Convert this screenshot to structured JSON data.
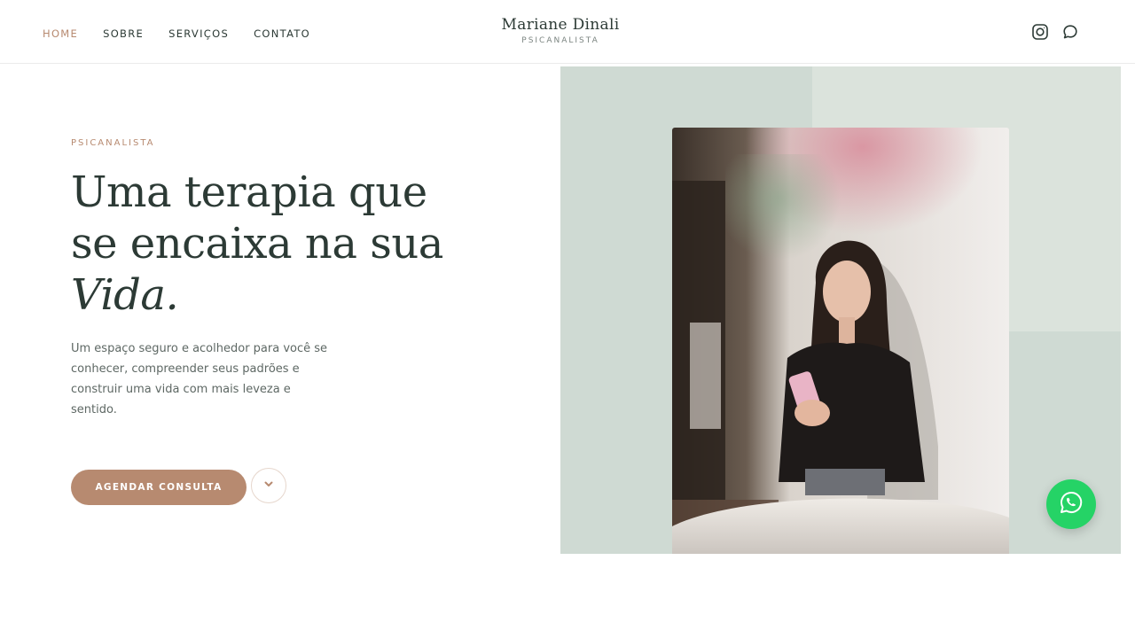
{
  "nav": {
    "items": [
      {
        "label": "HOME",
        "active": true
      },
      {
        "label": "SOBRE",
        "active": false
      },
      {
        "label": "SERVIÇOS",
        "active": false
      },
      {
        "label": "CONTATO",
        "active": false
      }
    ]
  },
  "brand": {
    "name": "Mariane Dinali",
    "subtitle": "PSICANALISTA"
  },
  "social": {
    "icons": [
      "instagram-icon",
      "chat-icon"
    ]
  },
  "hero": {
    "eyebrow": "PSICANALISTA",
    "headline_line1": "Uma terapia que",
    "headline_line2": "se encaixa na sua",
    "headline_line3": "Vida.",
    "description": "Um espaço seguro e acolhedor para você se conhecer, compreender seus padrões e construir uma vida com mais leveza e sentido.",
    "cta_label": "AGENDAR CONSULTA",
    "scroll_icon": "chevron-down-icon"
  },
  "floating": {
    "icon": "whatsapp-icon"
  },
  "colors": {
    "accent": "#b78a70",
    "text": "#2c3a35",
    "sage": "#cfdad3",
    "sage_light": "#dbe3dc",
    "whatsapp": "#25d366"
  }
}
